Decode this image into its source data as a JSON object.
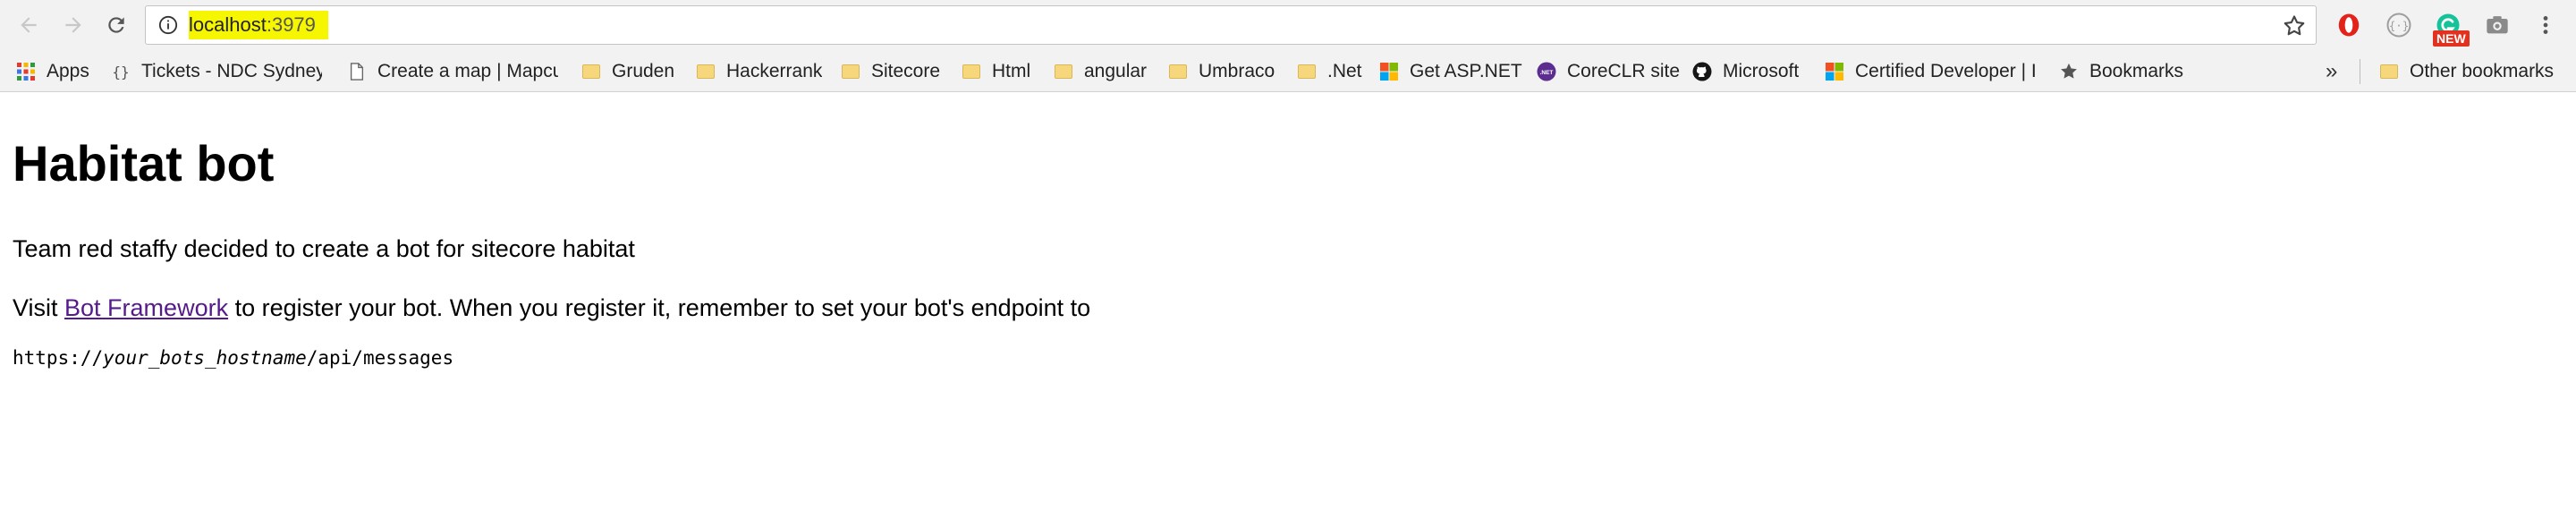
{
  "browser": {
    "address_bar": {
      "host": "localhost",
      "port": ":3979"
    },
    "new_badge": "NEW"
  },
  "bookmarks": {
    "items": [
      {
        "label": "Apps",
        "icon": "apps-grid-icon"
      },
      {
        "label": "Tickets - NDC Sydney",
        "icon": "code-braces-icon"
      },
      {
        "label": "Create a map | Mapcu",
        "icon": "page-icon"
      },
      {
        "label": "Gruden",
        "icon": "folder-icon"
      },
      {
        "label": "Hackerrank",
        "icon": "folder-icon"
      },
      {
        "label": "Sitecore",
        "icon": "folder-icon"
      },
      {
        "label": "Html",
        "icon": "folder-icon"
      },
      {
        "label": "angular",
        "icon": "folder-icon"
      },
      {
        "label": "Umbraco",
        "icon": "folder-icon"
      },
      {
        "label": ".Net",
        "icon": "folder-icon"
      },
      {
        "label": "Get ASP.NET",
        "icon": "microsoft-logo-icon"
      },
      {
        "label": "CoreCLR site",
        "icon": "dotnet-logo-icon"
      },
      {
        "label": "Microsoft",
        "icon": "github-icon"
      },
      {
        "label": "Certified Developer | I",
        "icon": "microsoft-logo-icon"
      },
      {
        "label": "Bookmarks",
        "icon": "star-icon"
      }
    ],
    "overflow": "»",
    "other": "Other bookmarks"
  },
  "page": {
    "title": "Habitat bot",
    "intro": "Team red staffy decided to create a bot for sitecore habitat",
    "visit_prefix": "Visit ",
    "link_text": "Bot Framework",
    "visit_suffix": " to register your bot. When you register it, remember to set your bot's endpoint to",
    "code_prefix": "https://",
    "code_italic": "your_bots_hostname",
    "code_suffix": "/api/messages"
  }
}
